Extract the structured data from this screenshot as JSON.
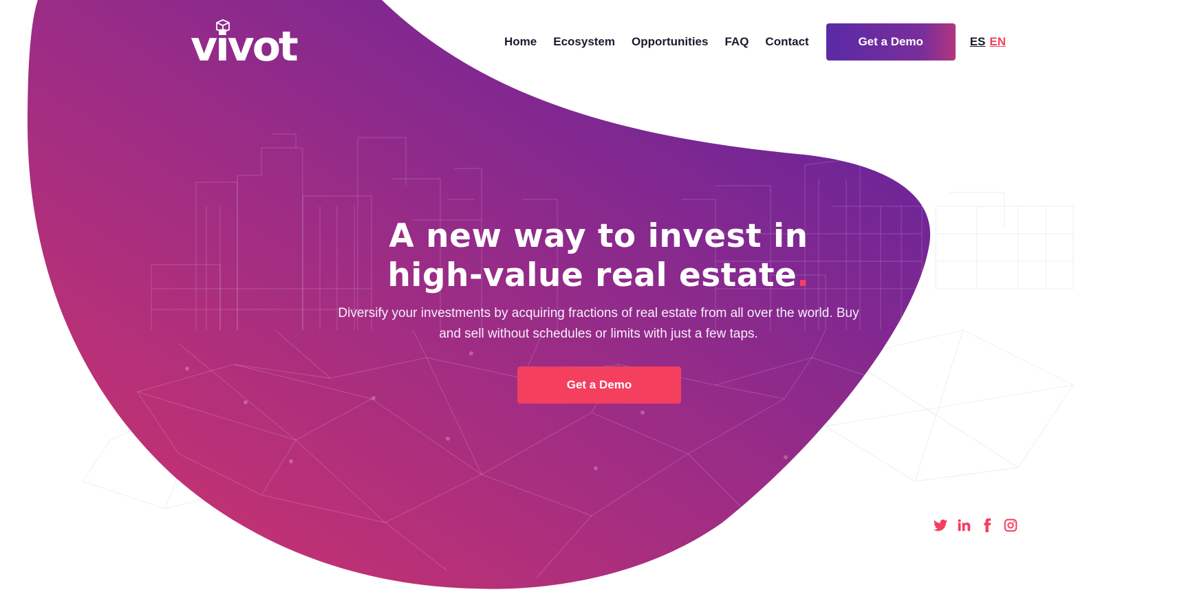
{
  "brand": {
    "logo_text": "vivot"
  },
  "nav": {
    "items": [
      {
        "label": "Home"
      },
      {
        "label": "Ecosystem"
      },
      {
        "label": "Opportunities"
      },
      {
        "label": "FAQ"
      },
      {
        "label": "Contact"
      }
    ],
    "cta_label": "Get a Demo",
    "languages": [
      "ES",
      "EN"
    ],
    "active_language": "EN"
  },
  "hero": {
    "title_line1": "A new way to invest in",
    "title_line2": "high-value real estate",
    "title_dot": ".",
    "subtitle": "Diversify your investments by acquiring fractions of real estate from all over the world. Buy and sell without schedules or limits with just a few taps.",
    "cta_label": "Get a Demo"
  },
  "social": {
    "icons": [
      "twitter-icon",
      "linkedin-icon",
      "facebook-icon",
      "instagram-icon"
    ]
  },
  "colors": {
    "accent": "#f43f5e",
    "gradient_purple": "#5a2aa6",
    "gradient_magenta": "#c2306e",
    "nav_text": "#1a1a2e"
  }
}
